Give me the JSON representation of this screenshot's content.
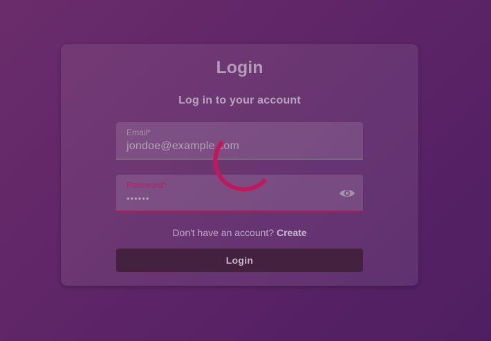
{
  "login_card": {
    "title": "Login",
    "subtitle": "Log in to your account",
    "email": {
      "label": "Email*",
      "value": "jondoe@example.com"
    },
    "password": {
      "label": "Password*",
      "value": "••••••",
      "toggle_icon": "eye-icon"
    },
    "signup_prompt": "Don't have an account?",
    "signup_link": "Create",
    "login_button": "Login"
  },
  "loading": {
    "icon": "loading-spinner"
  },
  "colors": {
    "background": "#5e2567",
    "accent": "#c2185b",
    "button": "#44213f"
  }
}
